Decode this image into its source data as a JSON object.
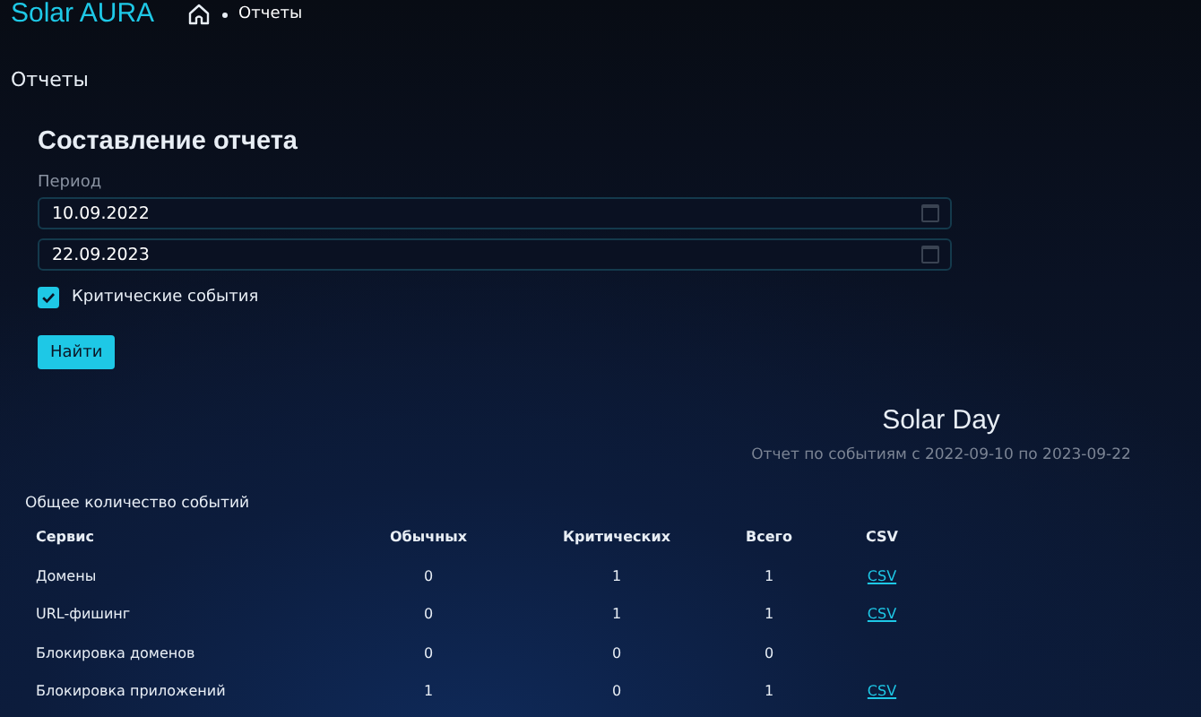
{
  "header": {
    "brand": "Solar AURA",
    "breadcrumb": [
      {
        "label": "Отчеты"
      }
    ]
  },
  "page_title": "Отчеты",
  "form": {
    "title": "Составление отчета",
    "period_label": "Период",
    "date_from": "10.09.2022",
    "date_to": "22.09.2023",
    "critical": {
      "label": "Критические события",
      "checked": true
    },
    "button": "Найти"
  },
  "report": {
    "title": "Solar Day",
    "subtitle": "Отчет по событиям с 2022-09-10 по 2023-09-22"
  },
  "table": {
    "caption": "Общее количество событий",
    "columns": [
      "Сервис",
      "Обычных",
      "Критических",
      "Всего",
      "CSV"
    ],
    "rows": [
      {
        "cells": [
          "Домены",
          "0",
          "1",
          "1"
        ],
        "csv": "CSV"
      },
      {
        "cells": [
          "URL-фишинг",
          "0",
          "1",
          "1"
        ],
        "csv": "CSV"
      },
      {
        "cells": [
          "Блокировка доменов",
          "0",
          "0",
          "0"
        ]
      },
      {
        "cells": [
          "Блокировка приложений",
          "1",
          "0",
          "1"
        ],
        "csv": "CSV"
      }
    ]
  }
}
